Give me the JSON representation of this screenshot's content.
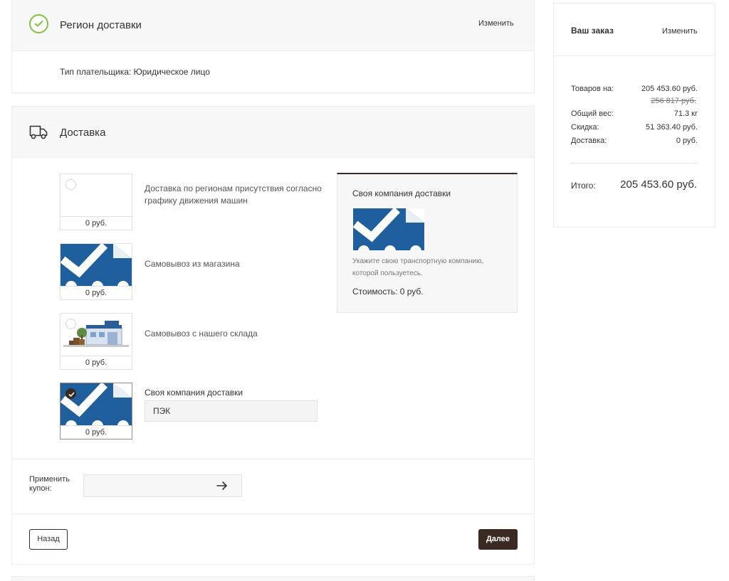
{
  "region": {
    "title": "Регион доставки",
    "change": "Изменить",
    "payer_type": "Тип плательщика: Юридическое лицо"
  },
  "delivery": {
    "title": "Доставка",
    "options": [
      {
        "label": "Доставка по регионам присутствия согласно графику движения машин",
        "price": "0 руб.",
        "image": "blank",
        "selected": false
      },
      {
        "label": "Самовывоз из магазина",
        "price": "0 руб.",
        "image": "checkmark-logo",
        "selected": false
      },
      {
        "label": "Самовывоз с нашего склада",
        "price": "0 руб.",
        "image": "warehouse",
        "selected": false
      },
      {
        "label": "Своя компания доставки",
        "price": "0 руб.",
        "image": "checkmark-logo",
        "selected": true
      }
    ],
    "selected_company_value": "ПЭК",
    "info": {
      "title": "Своя компания доставки",
      "description": "Укажите свою транспортную компанию, которой пользуетесь.",
      "cost": "Стоимость: 0 руб."
    },
    "coupon_label": "Применить купон:",
    "coupon_value": "",
    "back_label": "Назад",
    "next_label": "Далее"
  },
  "summary": {
    "title": "Ваш заказ",
    "change": "Изменить",
    "rows": [
      {
        "label": "Товаров на:",
        "value": "205 453.60 руб."
      },
      {
        "label": "Общий вес:",
        "value": "71.3 кг"
      },
      {
        "label": "Скидка:",
        "value": "51 363.40 руб."
      },
      {
        "label": "Доставка:",
        "value": "0 руб."
      }
    ],
    "old_price": "256 817 руб.",
    "total_label": "Итого:",
    "total_value": "205 453.60 руб."
  },
  "colors": {
    "accent": "#3a2a22",
    "success": "#7ec243",
    "logo_blue": "#1f5f9e"
  }
}
